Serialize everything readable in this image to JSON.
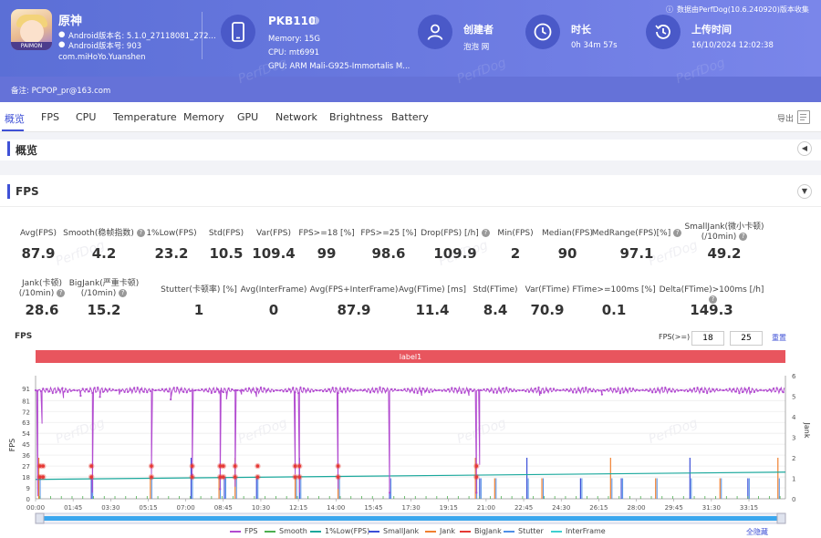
{
  "app": {
    "name": "原神",
    "icon_label": "PAIMON",
    "version": "Android版本名: 5.1.0_27118081_272...",
    "build": "Android版本号: 903",
    "package": "com.miHoYo.Yuanshen"
  },
  "device": {
    "model": "PKB110",
    "memory": "Memory: 15G",
    "cpu": "CPU: mt6991",
    "gpu": "GPU: ARM Mali-G925-Immortalis M..."
  },
  "creator": {
    "title": "创建者",
    "value": "泡泡 网"
  },
  "duration": {
    "title": "时长",
    "value": "0h 34m 57s"
  },
  "upload": {
    "title": "上传时间",
    "value": "16/10/2024 12:02:38"
  },
  "data_source": "数据由PerfDog(10.6.240920)版本收集",
  "note": "备注:  PCPOP_pr@163.com",
  "tabs": [
    "概览",
    "FPS",
    "CPU",
    "Temperature",
    "Memory",
    "GPU",
    "Network",
    "Brightness",
    "Battery"
  ],
  "export_label": "导出",
  "overview_title": "概览",
  "fps_title": "FPS",
  "stats_row1": [
    {
      "label": "Avg(FPS)",
      "value": "87.9"
    },
    {
      "label": "Smooth(稳帧指数)",
      "value": "4.2",
      "help": true
    },
    {
      "label": "1%Low(FPS)",
      "value": "23.2"
    },
    {
      "label": "Std(FPS)",
      "value": "10.5"
    },
    {
      "label": "Var(FPS)",
      "value": "109.4"
    },
    {
      "label": "FPS>=18 [%]",
      "value": "99"
    },
    {
      "label": "FPS>=25 [%]",
      "value": "98.6"
    },
    {
      "label": "Drop(FPS) [/h]",
      "value": "109.9",
      "help": true
    },
    {
      "label": "Min(FPS)",
      "value": "2"
    },
    {
      "label": "Median(FPS)",
      "value": "90"
    },
    {
      "label": "MedRange(FPS)[%]",
      "value": "97.1",
      "help": true
    },
    {
      "label": "SmallJank(微小卡顿)\n(/10min)",
      "value": "49.2",
      "help": true
    }
  ],
  "stats_row2": [
    {
      "label": "Jank(卡顿)\n(/10min)",
      "value": "28.6",
      "help": true
    },
    {
      "label": "BigJank(严重卡顿)\n(/10min)",
      "value": "15.2",
      "help": true
    },
    {
      "label": "Stutter(卡顿率) [%]",
      "value": "1"
    },
    {
      "label": "Avg(InterFrame)",
      "value": "0"
    },
    {
      "label": "Avg(FPS+InterFrame)",
      "value": "87.9"
    },
    {
      "label": "Avg(FTime) [ms]",
      "value": "11.4"
    },
    {
      "label": "Std(FTime)",
      "value": "8.4"
    },
    {
      "label": "Var(FTime)",
      "value": "70.9"
    },
    {
      "label": "FTime>=100ms [%]",
      "value": "0.1"
    },
    {
      "label": "Delta(FTime)>100ms [/h]",
      "value": "149.3",
      "help": true
    }
  ],
  "chart_controls": {
    "title": "FPS",
    "threshold_label": "FPS(>=)",
    "threshold1": "18",
    "threshold2": "25",
    "reset_label": "重置",
    "hide_all_label": "全隐藏"
  },
  "watermark": "PerfDog",
  "chart_data": {
    "type": "line",
    "title": "",
    "label_band": "label1",
    "ylabel": "FPS",
    "y2label": "Jank",
    "y_ticks": [
      0,
      9,
      18,
      27,
      36,
      45,
      54,
      63,
      72,
      81,
      91
    ],
    "ylim": [
      0,
      91
    ],
    "y2_ticks": [
      0,
      1,
      2,
      3,
      4,
      5,
      6
    ],
    "y2lim": [
      0,
      6
    ],
    "x_ticks": [
      "00:00",
      "01:45",
      "03:30",
      "05:15",
      "07:00",
      "08:45",
      "10:30",
      "12:15",
      "14:00",
      "15:45",
      "17:30",
      "19:15",
      "21:00",
      "22:45",
      "24:30",
      "26:15",
      "28:00",
      "29:45",
      "31:30",
      "33:15"
    ],
    "x_range_minutes": [
      0,
      34.95
    ],
    "fps_baseline": 89.5,
    "fps_dips": [
      {
        "t": 0.1,
        "fps": 2
      },
      {
        "t": 0.3,
        "fps": 62
      },
      {
        "t": 1.3,
        "fps": 83
      },
      {
        "t": 2.1,
        "fps": 85
      },
      {
        "t": 2.65,
        "fps": 5
      },
      {
        "t": 3.0,
        "fps": 84
      },
      {
        "t": 3.9,
        "fps": 86
      },
      {
        "t": 5.4,
        "fps": 20
      },
      {
        "t": 6.3,
        "fps": 82
      },
      {
        "t": 7.3,
        "fps": 20
      },
      {
        "t": 8.6,
        "fps": 8
      },
      {
        "t": 8.9,
        "fps": 82
      },
      {
        "t": 9.3,
        "fps": 10
      },
      {
        "t": 9.6,
        "fps": 86
      },
      {
        "t": 10.3,
        "fps": 84
      },
      {
        "t": 12.1,
        "fps": 20
      },
      {
        "t": 12.3,
        "fps": 5
      },
      {
        "t": 14.1,
        "fps": 8
      },
      {
        "t": 16.5,
        "fps": 5
      },
      {
        "t": 18.0,
        "fps": 85
      },
      {
        "t": 20.2,
        "fps": 85
      },
      {
        "t": 20.55,
        "fps": 5
      },
      {
        "t": 20.7,
        "fps": 28
      },
      {
        "t": 23.5,
        "fps": 85
      },
      {
        "t": 26.4,
        "fps": 86
      },
      {
        "t": 33.3,
        "fps": 86
      }
    ],
    "series": [
      {
        "name": "FPS",
        "color": "#b24bd0"
      },
      {
        "name": "Smooth",
        "color": "#4caf50"
      },
      {
        "name": "1%Low(FPS)",
        "color": "#1aa89c"
      },
      {
        "name": "SmallJank",
        "color": "#3b4fd8"
      },
      {
        "name": "Jank",
        "color": "#f08030"
      },
      {
        "name": "BigJank",
        "color": "#e53935"
      },
      {
        "name": "Stutter",
        "color": "#4f8fe6"
      },
      {
        "name": "InterFrame",
        "color": "#3fd0d0"
      }
    ],
    "low1_line": {
      "start": 16,
      "end": 22
    },
    "bigjank_markers": [
      0.2,
      0.35,
      2.6,
      5.4,
      7.3,
      8.6,
      8.75,
      9.3,
      10.35,
      12.1,
      12.3,
      14.1,
      20.55
    ],
    "jank_bars": [
      0.15,
      2.6,
      5.35,
      7.25,
      8.55,
      8.8,
      9.3,
      10.3,
      12.1,
      12.3,
      14.1,
      16.5,
      20.5,
      20.7,
      21.4,
      22.9,
      23.6,
      25.4,
      26.8,
      27.3,
      28.9,
      30.5,
      31.9,
      33.2,
      34.6
    ]
  }
}
